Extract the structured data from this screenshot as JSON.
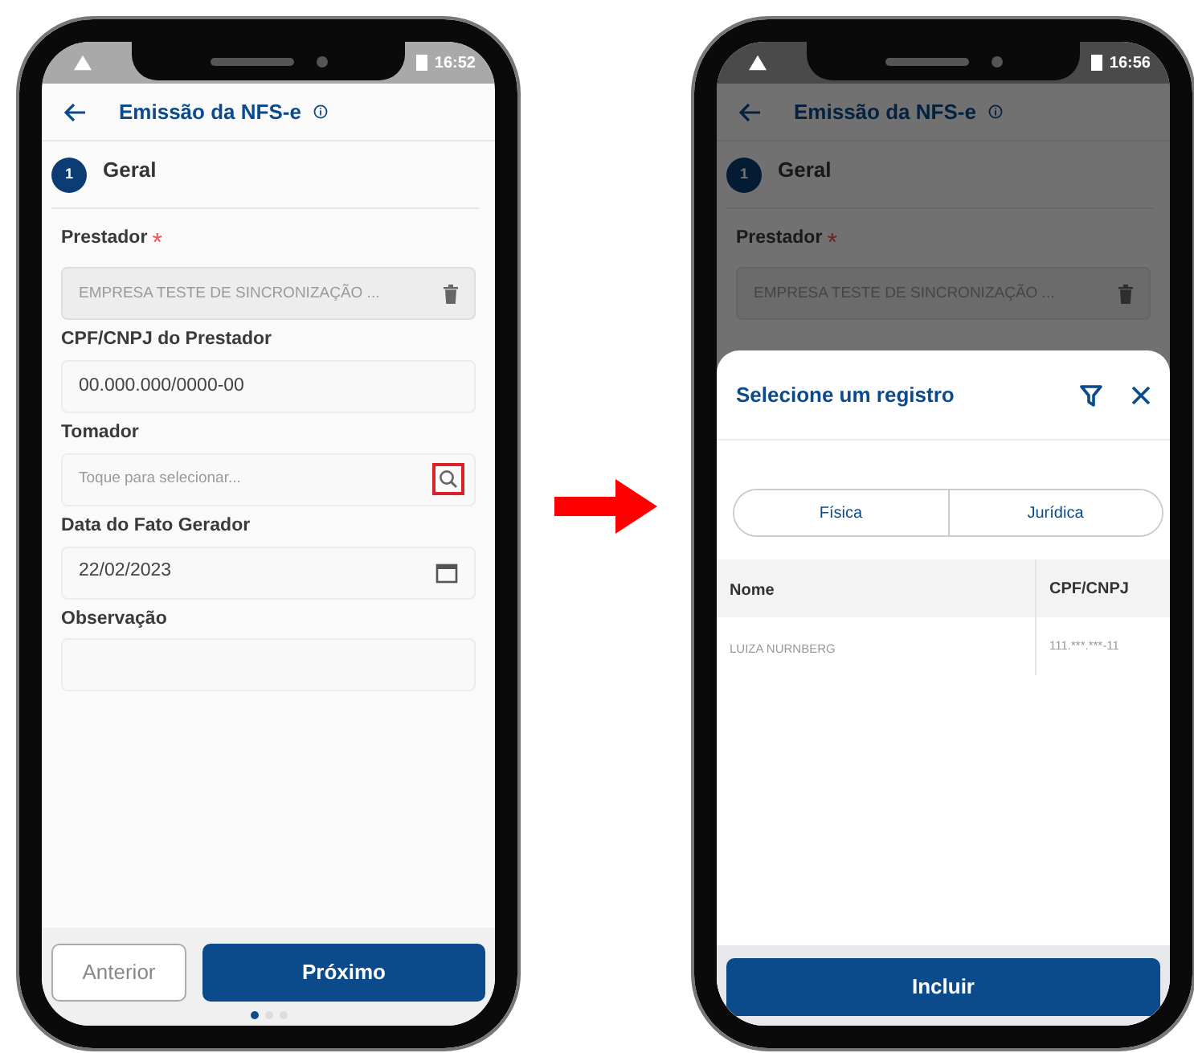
{
  "phones": [
    {
      "kind": "form",
      "status_bar": {
        "time": "16:52"
      },
      "header": {
        "title": "Emissão da NFS-e"
      },
      "step": {
        "number": "1",
        "title": "Geral"
      },
      "fields": [
        {
          "label": "Prestador",
          "required_mark": "*",
          "kind": "delete",
          "disabled": true,
          "value": "EMPRESA TESTE DE SINCRONIZAÇÃO ..."
        },
        {
          "label": "CPF/CNPJ do Prestador",
          "kind": "plain",
          "disabled": false,
          "value": "00.000.000/0000-00"
        },
        {
          "label": "Tomador",
          "kind": "search",
          "disabled": false,
          "placeholder": "Toque para selecionar...",
          "highlighted": true
        },
        {
          "label": "Data do Fato Gerador",
          "kind": "date",
          "disabled": false,
          "value": "22/02/2023"
        },
        {
          "label": "Observação",
          "kind": "plain",
          "disabled": false
        }
      ],
      "buttons": [
        {
          "label": "Anterior",
          "kind": "secondary"
        },
        {
          "label": "Próximo",
          "kind": "primary"
        }
      ],
      "page_dots": [
        {
          "selected": true
        },
        {
          "selected": false
        },
        {
          "selected": false
        }
      ]
    },
    {
      "kind": "dialog",
      "status_bar": {
        "time": "16:56"
      },
      "header": {
        "title": "Emissão da NFS-e"
      },
      "step": {
        "number": "1",
        "title": "Geral"
      },
      "fields": [
        {
          "label": "Prestador",
          "required_mark": "*",
          "kind": "delete",
          "disabled": true,
          "value": "EMPRESA TESTE DE SINCRONIZAÇÃO ..."
        }
      ],
      "dialog": {
        "title": "Selecione um registro",
        "segments": [
          "Física",
          "Jurídica"
        ],
        "table": {
          "columns": [
            "Nome",
            "CPF/CNPJ"
          ],
          "rows": [
            [
              "LUIZA NURNBERG",
              "111.***.***-11"
            ]
          ]
        },
        "button": "Incluir"
      }
    }
  ]
}
